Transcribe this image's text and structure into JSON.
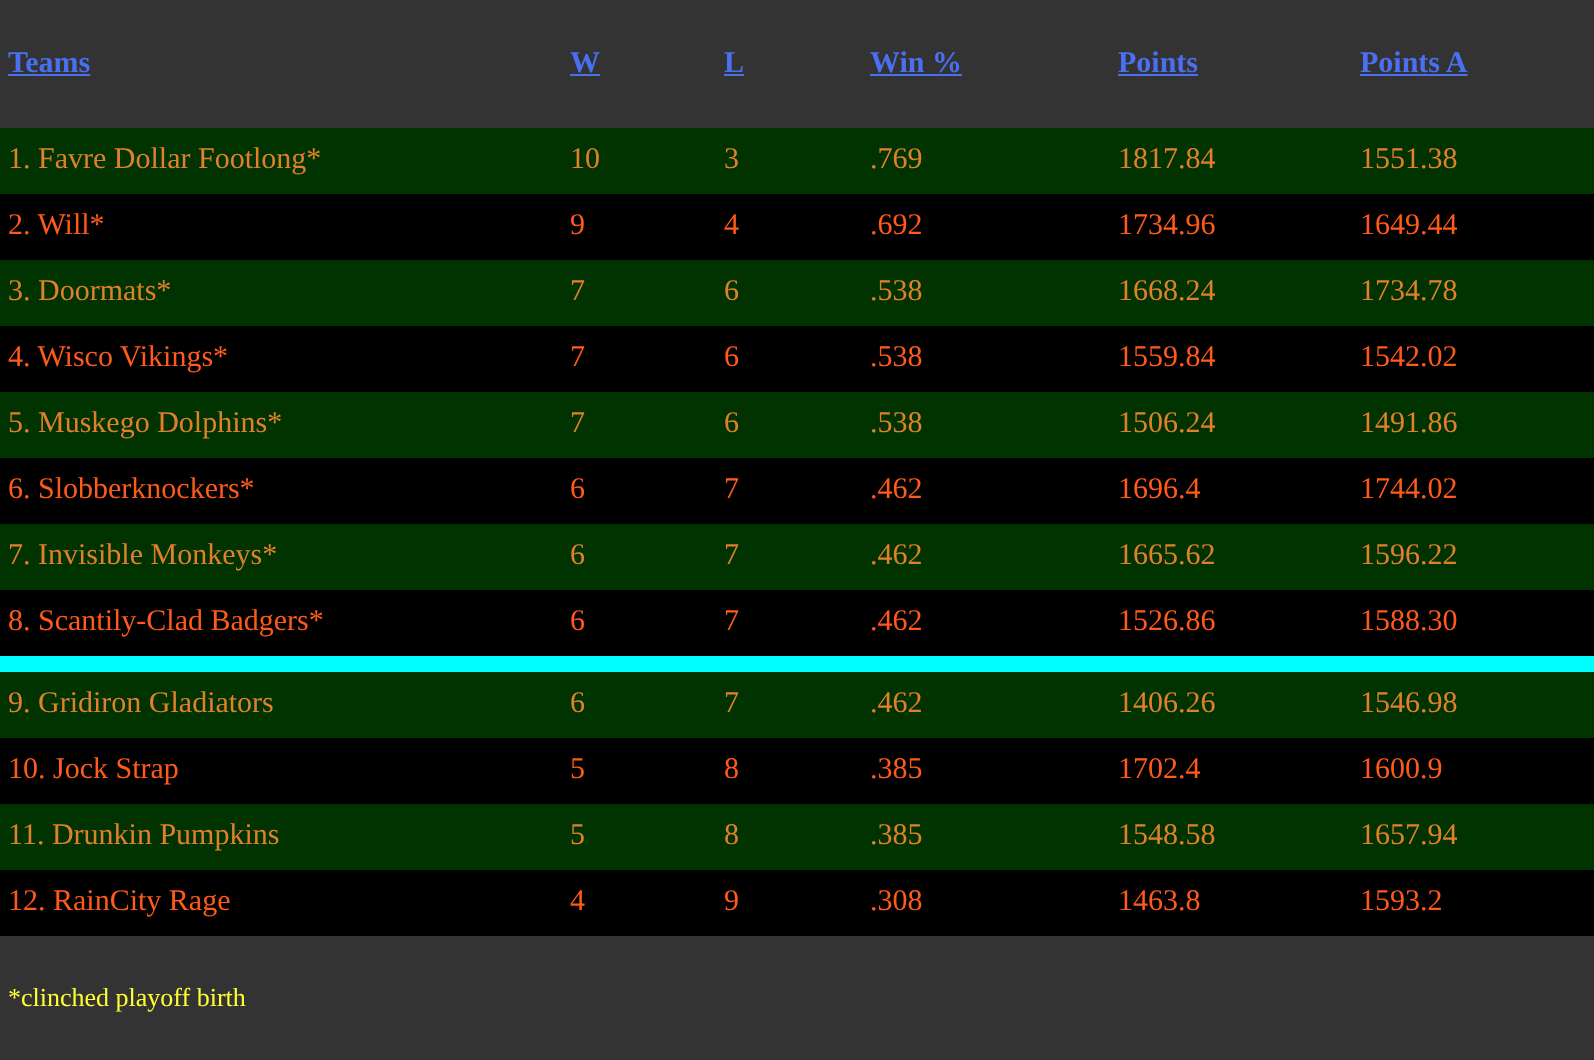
{
  "table": {
    "columns": [
      "Teams",
      "W",
      "L",
      "Win %",
      "Points",
      "Points A"
    ],
    "groups": [
      {
        "rows": [
          [
            "1. Favre Dollar Footlong*",
            "10",
            "3",
            ".769",
            "1817.84",
            "1551.38"
          ],
          [
            "2. Will*",
            "9",
            "4",
            ".692",
            "1734.96",
            "1649.44"
          ],
          [
            "3. Doormats*",
            "7",
            "6",
            ".538",
            "1668.24",
            "1734.78"
          ],
          [
            "4. Wisco Vikings*",
            "7",
            "6",
            ".538",
            "1559.84",
            "1542.02"
          ],
          [
            "5. Muskego Dolphins*",
            "7",
            "6",
            ".538",
            "1506.24",
            "1491.86"
          ],
          [
            "6. Slobberknockers*",
            "6",
            "7",
            ".462",
            "1696.4",
            "1744.02"
          ],
          [
            "7. Invisible Monkeys*",
            "6",
            "7",
            ".462",
            "1665.62",
            "1596.22"
          ],
          [
            "8. Scantily-Clad Badgers*",
            "6",
            "7",
            ".462",
            "1526.86",
            "1588.30"
          ]
        ]
      },
      {
        "rows": [
          [
            "9. Gridiron Gladiators",
            "6",
            "7",
            ".462",
            "1406.26",
            "1546.98"
          ],
          [
            "10. Jock Strap",
            "5",
            "8",
            ".385",
            "1702.4",
            "1600.9"
          ],
          [
            "11. Drunkin Pumpkins",
            "5",
            "8",
            ".385",
            "1548.58",
            "1657.94"
          ],
          [
            "12. RainCity Rage",
            "4",
            "9",
            ".308",
            "1463.8",
            "1593.2"
          ]
        ]
      }
    ]
  },
  "footnote": "*clinched playoff birth"
}
